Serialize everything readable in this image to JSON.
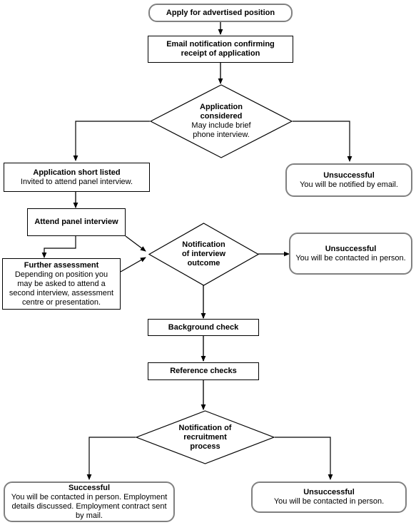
{
  "diagram": {
    "type": "flowchart",
    "title": "Recruitment application process flowchart",
    "nodes": {
      "apply": {
        "shape": "rounded-rectangle",
        "title": "Apply for advertised position",
        "desc": ""
      },
      "email_notification": {
        "shape": "rectangle",
        "title": "Email notification confirming receipt of application",
        "title_line1": "Email notification confirming",
        "title_line2": "receipt of application",
        "desc": ""
      },
      "application_considered": {
        "shape": "diamond",
        "title_line1": "Application",
        "title_line2": "considered",
        "desc_line1": "May include brief",
        "desc_line2": "phone interview."
      },
      "short_listed": {
        "shape": "rectangle",
        "title": "Application short listed",
        "desc": "Invited to attend panel interview."
      },
      "unsuccessful_email": {
        "shape": "rounded-rectangle",
        "title": "Unsuccessful",
        "desc": "You will be notified by email."
      },
      "attend_panel_interview": {
        "shape": "rectangle",
        "title": "Attend panel interview",
        "desc": ""
      },
      "further_assessment": {
        "shape": "rectangle",
        "title": "Further assessment",
        "desc_line1": "Depending on position you",
        "desc_line2": "may be asked to attend a",
        "desc_line3": "second interview, assessment",
        "desc_line4": "centre or presentation."
      },
      "notification_interview_outcome": {
        "shape": "diamond",
        "title_line1": "Notification",
        "title_line2": "of interview",
        "title_line3": "outcome"
      },
      "unsuccessful_interview": {
        "shape": "rounded-rectangle",
        "title": "Unsuccessful",
        "desc": "You will be contacted in person."
      },
      "background_check": {
        "shape": "rectangle",
        "title": "Background check",
        "desc": ""
      },
      "reference_checks": {
        "shape": "rectangle",
        "title": "Reference checks",
        "desc": ""
      },
      "notification_recruitment_process": {
        "shape": "diamond",
        "title_line1": "Notification of",
        "title_line2": "recruitment",
        "title_line3": "process"
      },
      "successful": {
        "shape": "rounded-rectangle",
        "title": "Successful",
        "desc_line1": "You will be contacted in person. Employment",
        "desc_line2": "details discussed. Employment contract sent",
        "desc_line3": "by mail."
      },
      "unsuccessful_final": {
        "shape": "rounded-rectangle",
        "title": "Unsuccessful",
        "desc": "You will be contacted in person."
      }
    },
    "colors": {
      "rect_border": "#000000",
      "rounded_border": "#808080",
      "edge": "#555555",
      "diamond_border": "#000000",
      "text": "#000000",
      "background": "#ffffff"
    }
  }
}
